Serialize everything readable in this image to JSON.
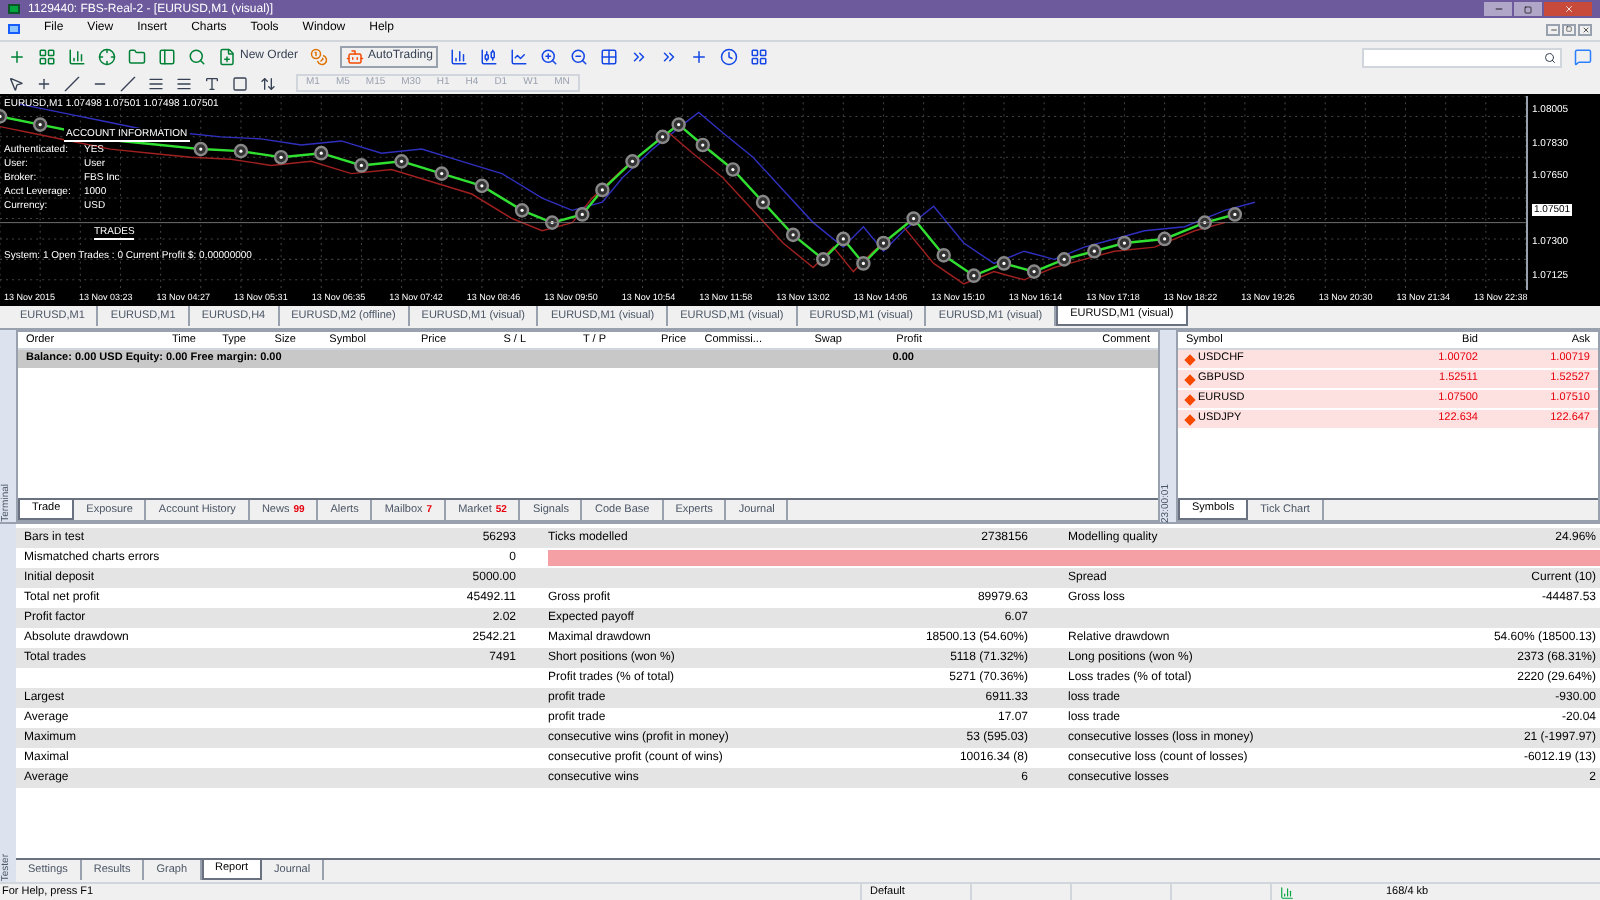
{
  "window": {
    "title": "1129440: FBS-Real-2 - [EURUSD,M1 (visual)]"
  },
  "menu": [
    "File",
    "View",
    "Insert",
    "Charts",
    "Tools",
    "Window",
    "Help"
  ],
  "toolbar": {
    "new_order": "New Order",
    "autotrading": "AutoTrading"
  },
  "timeframes": [
    "M1",
    "M5",
    "M15",
    "M30",
    "H1",
    "H4",
    "D1",
    "W1",
    "MN"
  ],
  "chart": {
    "info": "EURUSD,M1  1.07498 1.07501 1.07498 1.07501",
    "account_title": "ACCOUNT INFORMATION",
    "fields": [
      {
        "label": "Authenticated:",
        "value": "YES"
      },
      {
        "label": "User:",
        "value": "User"
      },
      {
        "label": "Broker:",
        "value": "FBS Inc"
      },
      {
        "label": "Acct Leverage:",
        "value": "1000"
      },
      {
        "label": "Currency:",
        "value": "USD"
      }
    ],
    "trades_title": "TRADES",
    "system_line": "System: 1 Open Trades : 0  Current Profit $: 0.00000000",
    "price_labels": [
      {
        "text": "1.08005",
        "current": false
      },
      {
        "text": "1.07830",
        "current": false
      },
      {
        "text": "1.07650",
        "current": false
      },
      {
        "text": "1.07501",
        "current": true
      },
      {
        "text": "1.07300",
        "current": false
      },
      {
        "text": "1.07125",
        "current": false
      }
    ],
    "time_labels": [
      "13 Nov 2015",
      "13 Nov 03:23",
      "13 Nov 04:27",
      "13 Nov 05:31",
      "13 Nov 06:35",
      "13 Nov 07:42",
      "13 Nov 08:46",
      "13 Nov 09:50",
      "13 Nov 10:54",
      "13 Nov 11:58",
      "13 Nov 13:02",
      "13 Nov 14:06",
      "13 Nov 15:10",
      "13 Nov 16:14",
      "13 Nov 17:18",
      "13 Nov 18:22",
      "13 Nov 19:26",
      "13 Nov 20:30",
      "13 Nov 21:34",
      "13 Nov 22:38"
    ]
  },
  "chart_tabs": [
    {
      "label": "EURUSD,M1",
      "selected": false
    },
    {
      "label": "EURUSD,M1",
      "selected": false
    },
    {
      "label": "EURUSD,H4",
      "selected": false
    },
    {
      "label": "EURUSD,M2 (offline)",
      "selected": false
    },
    {
      "label": "EURUSD,M1 (visual)",
      "selected": false
    },
    {
      "label": "EURUSD,M1 (visual)",
      "selected": false
    },
    {
      "label": "EURUSD,M1 (visual)",
      "selected": false
    },
    {
      "label": "EURUSD,M1 (visual)",
      "selected": false
    },
    {
      "label": "EURUSD,M1 (visual)",
      "selected": false
    },
    {
      "label": "EURUSD,M1 (visual)",
      "selected": true
    }
  ],
  "terminal": {
    "side_label": "Terminal",
    "columns": [
      "Order",
      "Time",
      "Type",
      "Size",
      "Symbol",
      "Price",
      "S / L",
      "T / P",
      "Price",
      "Commissi...",
      "Swap",
      "Profit",
      "Comment"
    ],
    "balance_row": {
      "text": "Balance: 0.00 USD  Equity: 0.00  Free margin: 0.00",
      "profit": "0.00"
    },
    "tabs": [
      {
        "label": "Trade",
        "selected": true
      },
      {
        "label": "Exposure",
        "selected": false
      },
      {
        "label": "Account History",
        "selected": false
      },
      {
        "label": "News",
        "badge": "99",
        "selected": false
      },
      {
        "label": "Alerts",
        "selected": false
      },
      {
        "label": "Mailbox",
        "badge": "7",
        "selected": false
      },
      {
        "label": "Market",
        "badge": "52",
        "selected": false
      },
      {
        "label": "Signals",
        "selected": false
      },
      {
        "label": "Code Base",
        "selected": false
      },
      {
        "label": "Experts",
        "selected": false
      },
      {
        "label": "Journal",
        "selected": false
      }
    ]
  },
  "market_watch": {
    "time": "23:00:01",
    "columns": [
      "Symbol",
      "Bid",
      "Ask"
    ],
    "rows": [
      {
        "symbol": "USDCHF",
        "bid": "1.00702",
        "ask": "1.00719"
      },
      {
        "symbol": "GBPUSD",
        "bid": "1.52511",
        "ask": "1.52527"
      },
      {
        "symbol": "EURUSD",
        "bid": "1.07500",
        "ask": "1.07510"
      },
      {
        "symbol": "USDJPY",
        "bid": "122.634",
        "ask": "122.647"
      }
    ],
    "tabs": [
      {
        "label": "Symbols",
        "selected": true
      },
      {
        "label": "Tick Chart",
        "selected": false
      }
    ]
  },
  "tester": {
    "side_label": "Tester",
    "rows": [
      {
        "kind": "text",
        "cells": [
          "Bars in test",
          "56293",
          "Ticks modelled",
          "2738156",
          "Modelling quality",
          "24.96%"
        ]
      },
      {
        "kind": "quality_bar",
        "cells": [
          "Mismatched charts errors",
          "0"
        ]
      },
      {
        "kind": "text",
        "cells": [
          "Initial deposit",
          "5000.00",
          "",
          "",
          "Spread",
          "Current (10)"
        ]
      },
      {
        "kind": "text",
        "cells": [
          "Total net profit",
          "45492.11",
          "Gross profit",
          "89979.63",
          "Gross loss",
          "-44487.53"
        ]
      },
      {
        "kind": "text",
        "cells": [
          "Profit factor",
          "2.02",
          "Expected payoff",
          "6.07",
          "",
          ""
        ]
      },
      {
        "kind": "text",
        "cells": [
          "Absolute drawdown",
          "2542.21",
          "Maximal drawdown",
          "18500.13 (54.60%)",
          "Relative drawdown",
          "54.60% (18500.13)"
        ]
      },
      {
        "kind": "text",
        "cells": [
          "Total trades",
          "7491",
          "Short positions (won %)",
          "5118 (71.32%)",
          "Long positions (won %)",
          "2373 (68.31%)"
        ]
      },
      {
        "kind": "text",
        "cells": [
          "",
          "",
          "Profit trades (% of total)",
          "5271 (70.36%)",
          "Loss trades (% of total)",
          "2220 (29.64%)"
        ]
      },
      {
        "kind": "text",
        "cells": [
          "",
          "Largest",
          "profit trade",
          "6911.33",
          "loss trade",
          "-930.00"
        ]
      },
      {
        "kind": "text",
        "cells": [
          "",
          "Average",
          "profit trade",
          "17.07",
          "loss trade",
          "-20.04"
        ]
      },
      {
        "kind": "text",
        "cells": [
          "",
          "Maximum",
          "consecutive wins (profit in money)",
          "53 (595.03)",
          "consecutive losses (loss in money)",
          "21 (-1997.97)"
        ]
      },
      {
        "kind": "text",
        "cells": [
          "",
          "Maximal",
          "consecutive profit (count of wins)",
          "10016.34 (8)",
          "consecutive loss (count of losses)",
          "-6012.19 (13)"
        ]
      },
      {
        "kind": "text",
        "cells": [
          "",
          "Average",
          "consecutive wins",
          "6",
          "consecutive losses",
          "2"
        ]
      }
    ],
    "tabs": [
      {
        "label": "Settings",
        "selected": false
      },
      {
        "label": "Results",
        "selected": false
      },
      {
        "label": "Graph",
        "selected": false
      },
      {
        "label": "Report",
        "selected": true
      },
      {
        "label": "Journal",
        "selected": false
      }
    ]
  },
  "status_bar": {
    "help": "For Help, press F1",
    "profile": "Default",
    "traffic": "168/4 kb"
  }
}
